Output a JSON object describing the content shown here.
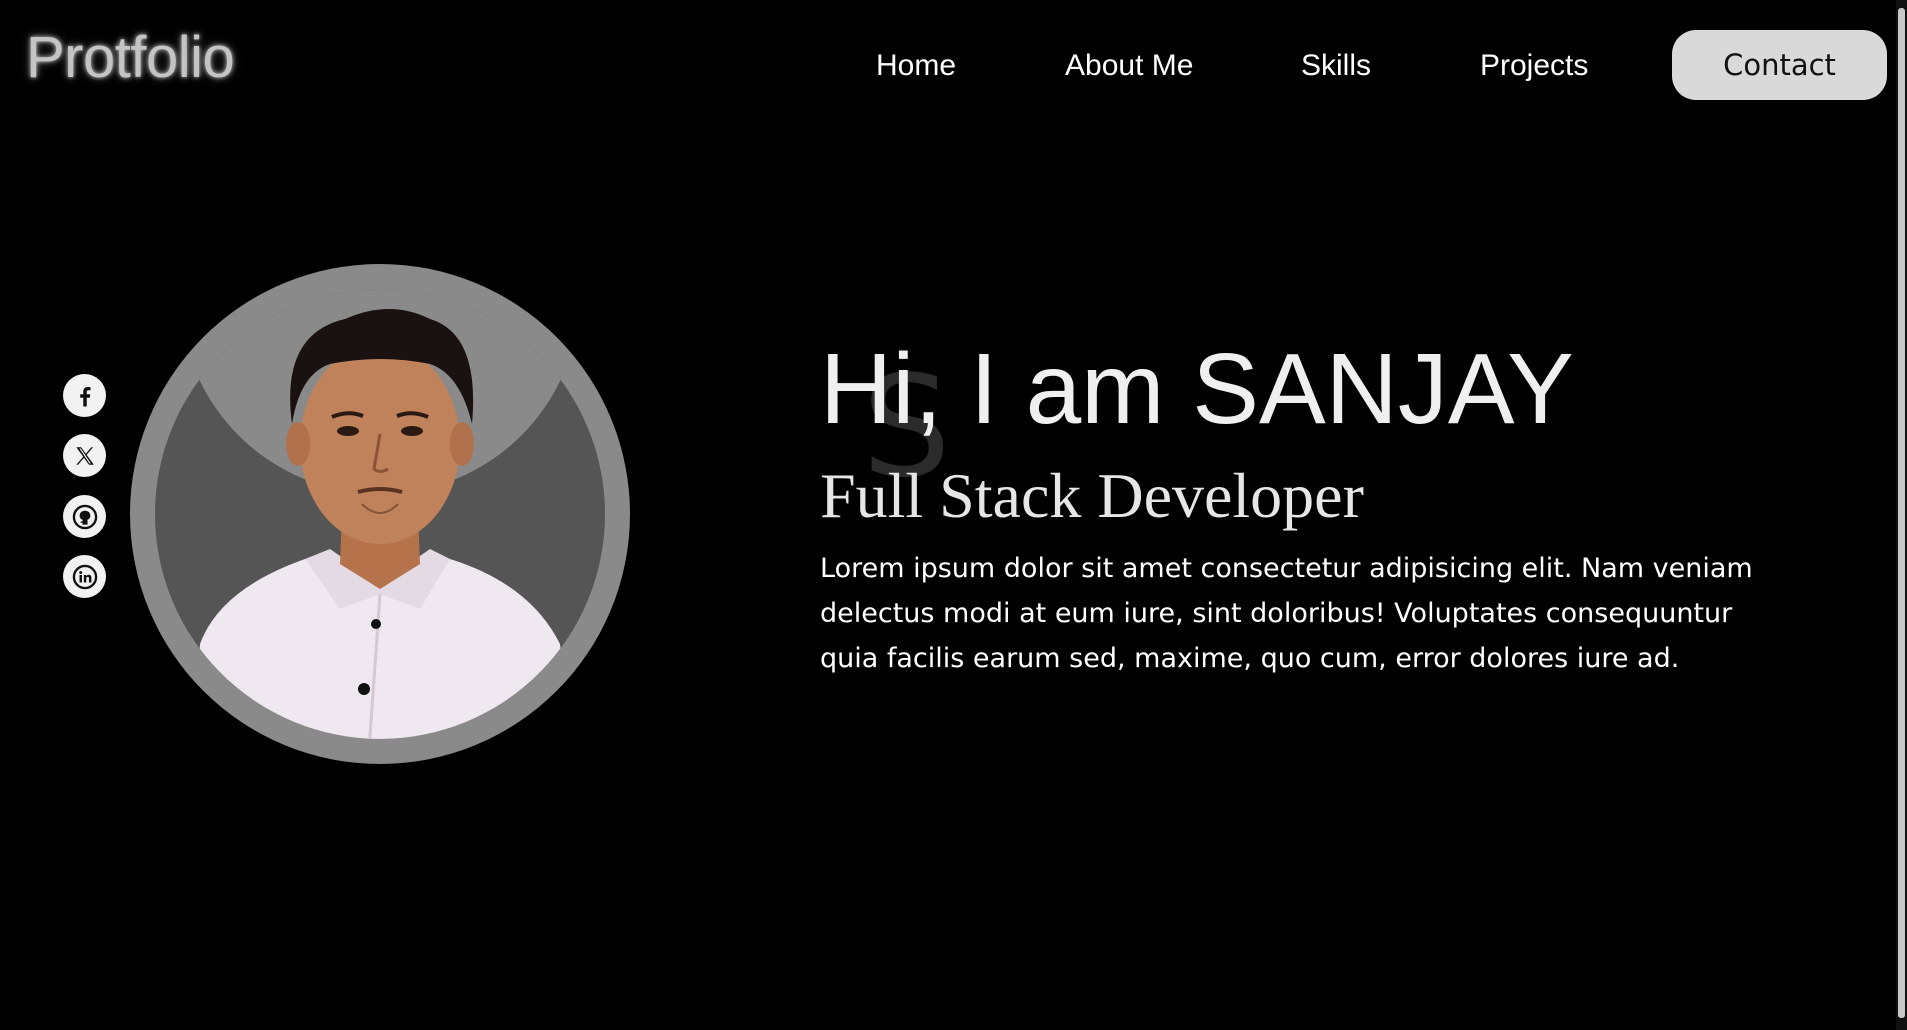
{
  "header": {
    "logo": "Protfolio",
    "nav": [
      "Home",
      "About Me",
      "Skills",
      "Projects"
    ],
    "contact_label": "Contact"
  },
  "social": {
    "icons": [
      "facebook-icon",
      "x-twitter-icon",
      "github-icon",
      "linkedin-icon"
    ]
  },
  "hero": {
    "ghost_letter": "S",
    "title": "Hi, I am SANJAY",
    "subtitle": "Full Stack Developer",
    "description": "Lorem ipsum dolor sit amet consectetur adipisicing elit. Nam veniam delectus modi at eum iure, sint doloribus! Voluptates consequuntur quia facilis earum sed, maxime, quo cum, error dolores iure ad."
  },
  "colors": {
    "background": "#000000",
    "contact_button": "#d9d9d9",
    "avatar_ring": "#8a8a8a",
    "avatar_inner": "#555555"
  }
}
